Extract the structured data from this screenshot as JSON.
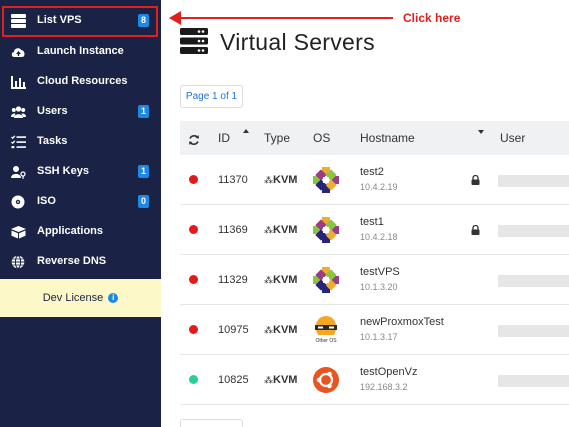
{
  "sidebar": {
    "items": [
      {
        "label": "List VPS",
        "badge": "8",
        "icon": "server-list-icon"
      },
      {
        "label": "Launch Instance",
        "badge": "",
        "icon": "cloud-upload-icon"
      },
      {
        "label": "Cloud Resources",
        "badge": "",
        "icon": "bar-chart-icon"
      },
      {
        "label": "Users",
        "badge": "1",
        "icon": "users-icon"
      },
      {
        "label": "Tasks",
        "badge": "",
        "icon": "task-list-icon"
      },
      {
        "label": "SSH Keys",
        "badge": "1",
        "icon": "user-key-icon"
      },
      {
        "label": "ISO",
        "badge": "0",
        "icon": "disc-icon"
      },
      {
        "label": "Applications",
        "badge": "",
        "icon": "boxes-icon"
      },
      {
        "label": "Reverse DNS",
        "badge": "",
        "icon": "globe-icon"
      }
    ],
    "dev_license": "Dev License"
  },
  "annotation": {
    "click_here": "Click here",
    "color": "#e0201c"
  },
  "main": {
    "title": "Virtual Servers",
    "pager": "Page 1 of 1",
    "columns": {
      "id": "ID",
      "type": "Type",
      "os": "OS",
      "hostname": "Hostname",
      "user": "User"
    },
    "rows": [
      {
        "status": "red",
        "id": "11370",
        "type": "KVM",
        "os": "centos-icon",
        "hostname": "test2",
        "ip": "10.4.2.19",
        "locked": true
      },
      {
        "status": "red",
        "id": "11369",
        "type": "KVM",
        "os": "centos-icon",
        "hostname": "test1",
        "ip": "10.4.2.18",
        "locked": true
      },
      {
        "status": "red",
        "id": "11329",
        "type": "KVM",
        "os": "centos-icon",
        "hostname": "testVPS",
        "ip": "10.1.3.20",
        "locked": false
      },
      {
        "status": "red",
        "id": "10975",
        "type": "KVM",
        "os": "other-os-icon",
        "os_label": "Other OS",
        "hostname": "newProxmoxTest",
        "ip": "10.1.3.17",
        "locked": false
      },
      {
        "status": "green",
        "id": "10825",
        "type": "KVM",
        "os": "ubuntu-icon",
        "hostname": "testOpenVz",
        "ip": "192.168.3.2",
        "locked": false
      }
    ]
  },
  "colors": {
    "sidebar": "#1a2245",
    "badge": "#1e88e5",
    "status_red": "#e01b1b",
    "status_green": "#2ecc9a",
    "accent": "#1e73d8"
  }
}
